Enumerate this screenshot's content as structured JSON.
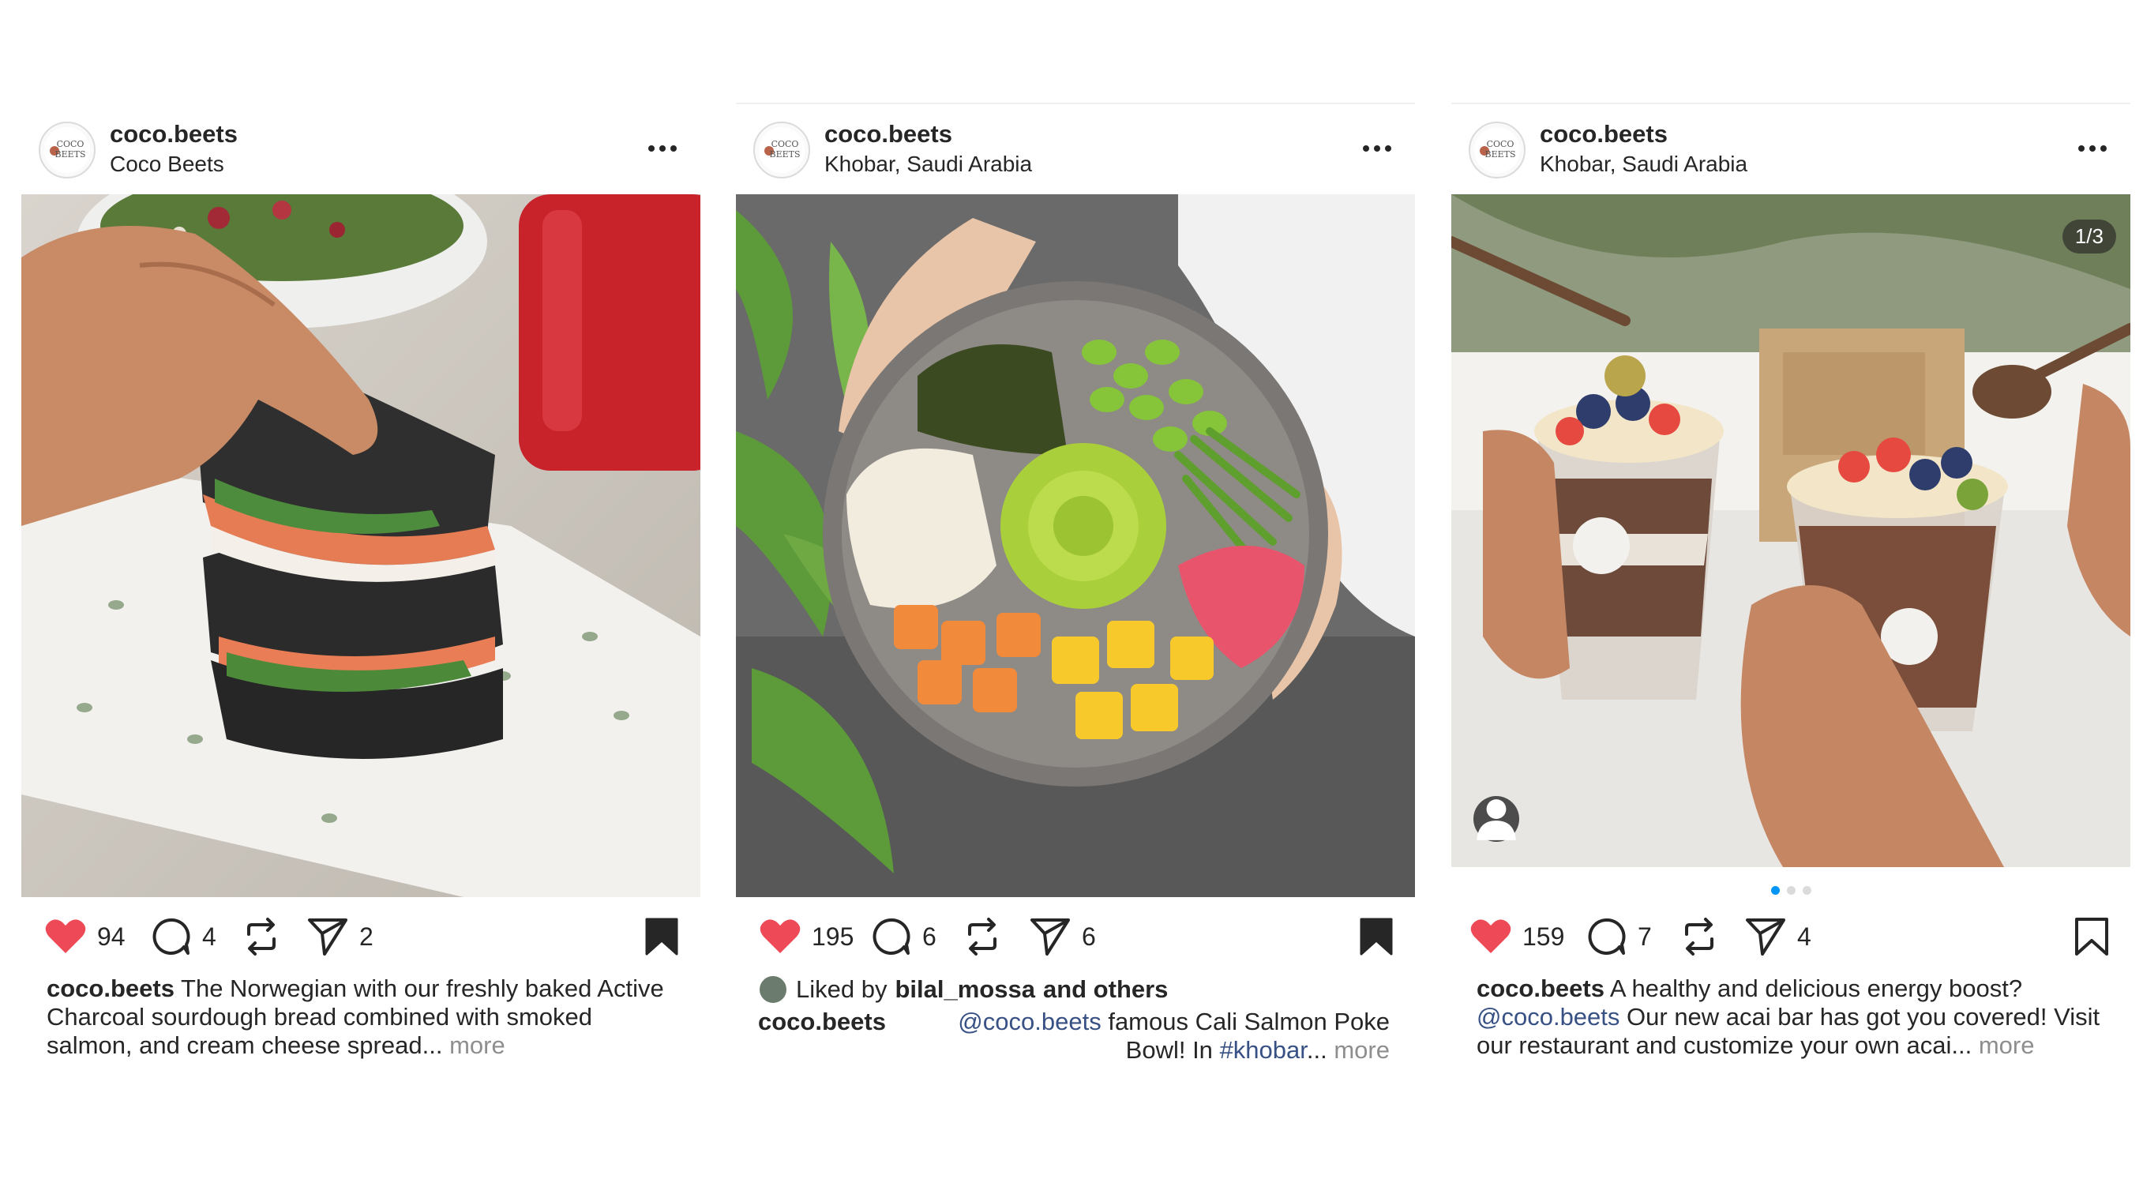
{
  "posts": [
    {
      "username": "coco.beets",
      "location": "Coco Beets",
      "likes": "94",
      "comments": "4",
      "shares": "2",
      "saved": true,
      "caption_user": "coco.beets",
      "caption_text": "The Norwegian with our freshly baked Active Charcoal sourdough bread combined with smoked salmon, and cream cheese spread...",
      "more_label": "more"
    },
    {
      "username": "coco.beets",
      "location": "Khobar, Saudi Arabia",
      "likes": "195",
      "comments": "6",
      "shares": "6",
      "saved": true,
      "liked_by_prefix": "Liked by",
      "liked_by_user": "bilal_mossa",
      "liked_by_suffix": "and others",
      "caption_user": "coco.beets",
      "caption_mention": "@coco.beets",
      "caption_text_1": "famous Cali Salmon Poke Bowl! In",
      "caption_hashtag": "#khobar",
      "caption_ellipsis": "...",
      "more_label": "more"
    },
    {
      "username": "coco.beets",
      "location": "Khobar, Saudi Arabia",
      "image_counter": "1/3",
      "likes": "159",
      "comments": "7",
      "shares": "4",
      "saved": false,
      "caption_user": "coco.beets",
      "caption_text_1": "A healthy and delicious energy boost?",
      "caption_mention": "@coco.beets",
      "caption_text_2": "Our new acai bar has got you covered! Visit our restaurant and customize your own acai...",
      "more_label": "more",
      "carousel_total": 3,
      "carousel_active": 1
    }
  ],
  "icons": {
    "like": "heart-icon",
    "comment": "comment-icon",
    "repost": "repost-icon",
    "share": "send-icon",
    "save": "bookmark-icon",
    "more": "more-horizontal-icon",
    "tag": "user-tag-icon"
  },
  "colors": {
    "like_red": "#ed4956",
    "link_blue": "#385185",
    "muted_gray": "#8e8e8e",
    "carousel_active": "#0095f6"
  }
}
